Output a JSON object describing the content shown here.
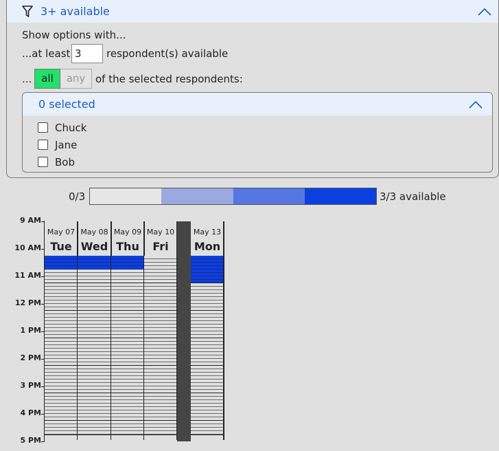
{
  "filter": {
    "title": "3+ available",
    "show_options": "Show options with...",
    "at_least_prefix": "...at least",
    "min_respondents": "3",
    "respondents_suffix": "respondent(s) available",
    "ellipsis": "...",
    "mode_all": "all",
    "mode_any": "any",
    "selected_mode": "all",
    "of_selected": "of the selected respondents:"
  },
  "respondents": {
    "header": "0 selected",
    "items": [
      {
        "name": "Chuck",
        "checked": false
      },
      {
        "name": "Jane",
        "checked": false
      },
      {
        "name": "Bob",
        "checked": false
      }
    ]
  },
  "legend": {
    "min_label": "0/3",
    "max_label": "3/3 available",
    "levels": 4,
    "colors": [
      "#e6e6e6",
      "#9aa9e0",
      "#5677e2",
      "#0b3fe0"
    ]
  },
  "schedule": {
    "time_labels": [
      "9 AM",
      "10 AM",
      "11 AM",
      "12 PM",
      "1 PM",
      "2 PM",
      "3 PM",
      "4 PM",
      "5 PM"
    ],
    "days": [
      {
        "date": "May 07",
        "weekday": "Tue",
        "available_slots": [
          0,
          1
        ]
      },
      {
        "date": "May 08",
        "weekday": "Wed",
        "available_slots": [
          0,
          1
        ]
      },
      {
        "date": "May 09",
        "weekday": "Thu",
        "available_slots": [
          0,
          1
        ]
      },
      {
        "date": "May 10",
        "weekday": "Fri",
        "available_slots": []
      },
      {
        "date": "May 13",
        "weekday": "Mon",
        "available_slots": [
          0,
          1,
          2,
          3
        ]
      }
    ],
    "slot_minutes": 15,
    "available_color": "#0b3fe0",
    "unavailable_color": "#e0e0e0"
  }
}
